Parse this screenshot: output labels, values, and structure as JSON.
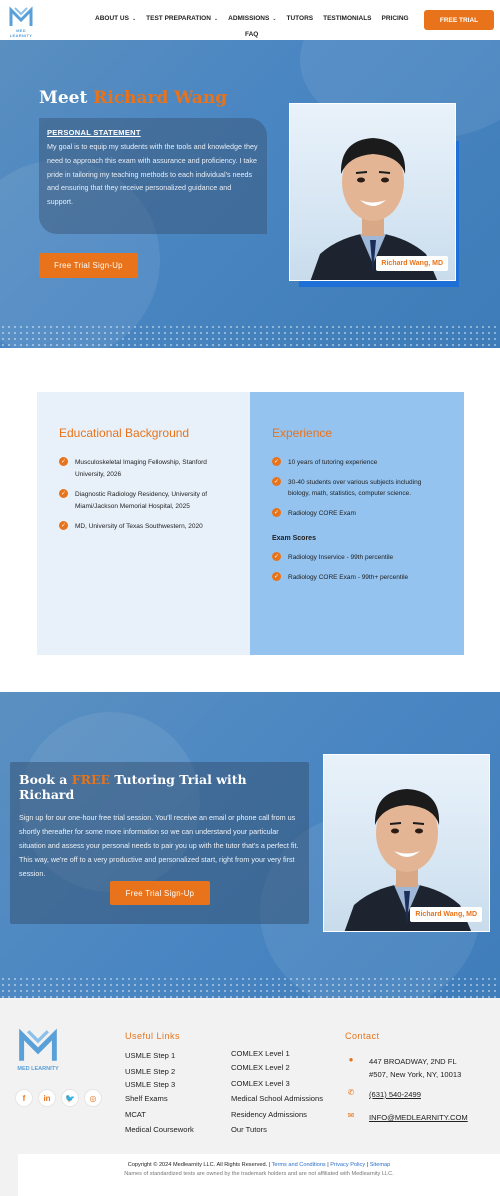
{
  "brand": {
    "name": "MED LEARNITY",
    "color": "#5aa0d8"
  },
  "colors": {
    "accent": "#e8731a",
    "primary": "#4a86c2"
  },
  "nav": {
    "items": [
      {
        "label": "ABOUT US",
        "dropdown": true
      },
      {
        "label": "TEST PREPARATION",
        "dropdown": true
      },
      {
        "label": "ADMISSIONS",
        "dropdown": true
      },
      {
        "label": "TUTORS",
        "dropdown": false
      },
      {
        "label": "TESTIMONIALS",
        "dropdown": false
      },
      {
        "label": "PRICING",
        "dropdown": false
      }
    ],
    "faq": "FAQ",
    "cta": "FREE TRIAL"
  },
  "hero": {
    "title_prefix": "Meet",
    "title_name": "Richard Wang",
    "statement_heading": "PERSONAL STATEMENT",
    "statement_text": "My goal is to equip my students with the tools and knowledge they need to approach this exam with assurance and proficiency. I take pride in tailoring my teaching methods to each individual's needs and ensuring that they receive personalized guidance and support.",
    "button": "Free Trial Sign-Up",
    "name_tag": "Richard Wang, MD"
  },
  "education": {
    "title": "Educational Background",
    "items": [
      "Musculoskeletal Imaging Fellowship, Stanford University, 2026",
      "Diagnostic Radiology Residency, University of Miami/Jackson Memorial Hospital, 2025",
      "MD, University of Texas Southwestern, 2020"
    ]
  },
  "experience": {
    "title": "Experience",
    "items": [
      "10 years of tutoring experience",
      "30-40 students over various subjects including biology, math, statistics, computer science.",
      "Radiology CORE Exam"
    ],
    "exam_heading": "Exam Scores",
    "exam_items": [
      "Radiology Inservice - 99th percentile",
      "Radiology CORE Exam - 99th+ percentile"
    ]
  },
  "book": {
    "title_pre": "Book a",
    "title_free": "FREE",
    "title_post": "Tutoring Trial with Richard",
    "text": "Sign up for our one-hour free trial session. You'll receive an email or phone call from us shortly thereafter for some more information so we can understand your particular situation and assess your personal needs to pair you up with the tutor that's a perfect fit. This way, we're off to a very productive and personalized start, right from your very first session.",
    "button": "Free Trial Sign-Up",
    "name_tag": "Richard Wang, MD"
  },
  "footer": {
    "logo_text": "MED LEARNITY",
    "useful_links_heading": "Useful Links",
    "links_col1": [
      "USMLE Step 1",
      "USMLE Step 2",
      "USMLE Step 3",
      "Shelf Exams",
      "MCAT",
      "Medical Coursework"
    ],
    "links_col2": [
      "COMLEX Level 1",
      "COMLEX Level 2",
      "COMLEX Level 3",
      "Medical School Admissions",
      "Residency Admissions",
      "Our Tutors"
    ],
    "contact_heading": "Contact",
    "address_line1": "447 BROADWAY, 2ND FL",
    "address_line2": "#507, New York, NY, 10013",
    "phone": "(631) 540-2499",
    "email": "INFO@MEDLEARNITY.COM",
    "copyright": "Copyright © 2024 Medlearnity LLC. All Rights Reserved.",
    "terms": "Terms and Conditions",
    "privacy": "Privacy Policy",
    "sitemap": "Sitemap",
    "disclaimer": "Names of standardized tests are owned by the trademark holders and are not affiliated with Medlearnity LLC."
  }
}
